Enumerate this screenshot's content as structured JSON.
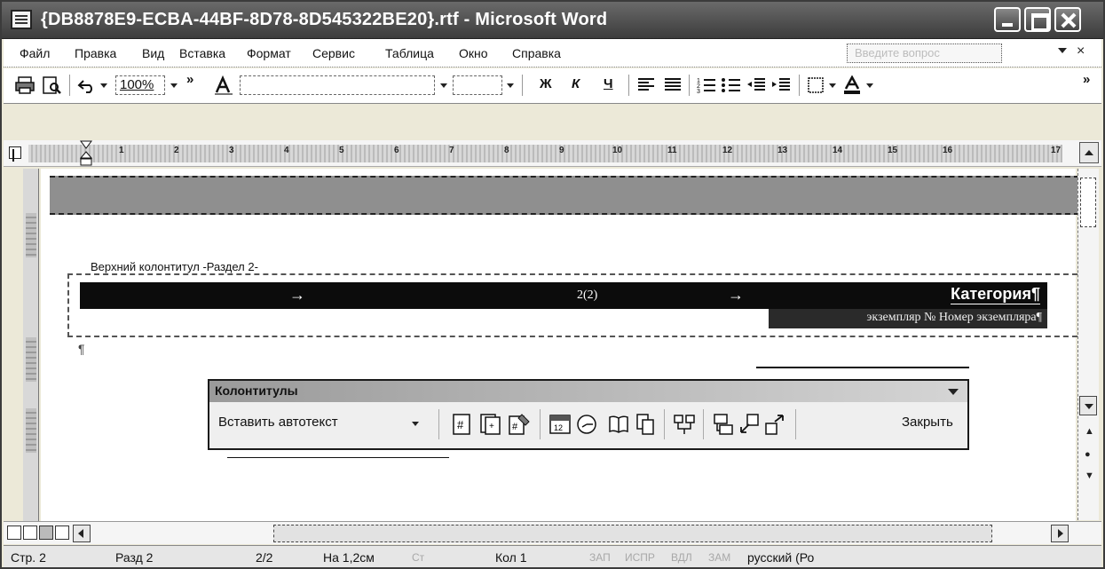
{
  "window": {
    "title": "{DB8878E9-ECBA-44BF-8D78-8D545322BE20}.rtf - Microsoft Word"
  },
  "menu": {
    "items": [
      "Файл",
      "Правка",
      "Вид",
      "Вставка",
      "Формат",
      "Сервис",
      "Таблица",
      "Окно",
      "Справка"
    ],
    "help_placeholder": "Введите вопрос"
  },
  "toolbar": {
    "zoom": "100%",
    "bold": "Ж",
    "italic": "К",
    "underline": "Ч",
    "more": "»"
  },
  "ruler": {
    "numbers": [
      "1",
      "2",
      "3",
      "4",
      "5",
      "6",
      "7",
      "8",
      "9",
      "10",
      "11",
      "12",
      "13",
      "14",
      "15",
      "16",
      "17"
    ]
  },
  "document": {
    "header_label": "Верхний колонтитул -Раздел 2-",
    "page_number": "2(2)",
    "category": "Категория¶",
    "copy_text": "экземпляр № Номер экземпляра¶",
    "para_mark": "¶"
  },
  "hf_toolbar": {
    "title": "Колонтитулы",
    "autotext": "Вставить автотекст",
    "close": "Закрыть",
    "icons": [
      "insert-page-number-icon",
      "insert-number-of-pages-icon",
      "format-page-number-icon",
      "insert-date-icon",
      "insert-time-icon",
      "page-setup-icon",
      "show-hide-text-icon",
      "same-as-previous-icon",
      "switch-header-footer-icon",
      "show-previous-icon",
      "show-next-icon"
    ]
  },
  "status": {
    "page": "Стр. 2",
    "section": "Разд 2",
    "pages": "2/2",
    "at": "На 1,2см",
    "line": "Ст",
    "col": "Кол 1",
    "rec": "ЗАП",
    "trk": "ИСПР",
    "ext": "ВДЛ",
    "ovr": "ЗАМ",
    "lang": "русский (Ро"
  }
}
